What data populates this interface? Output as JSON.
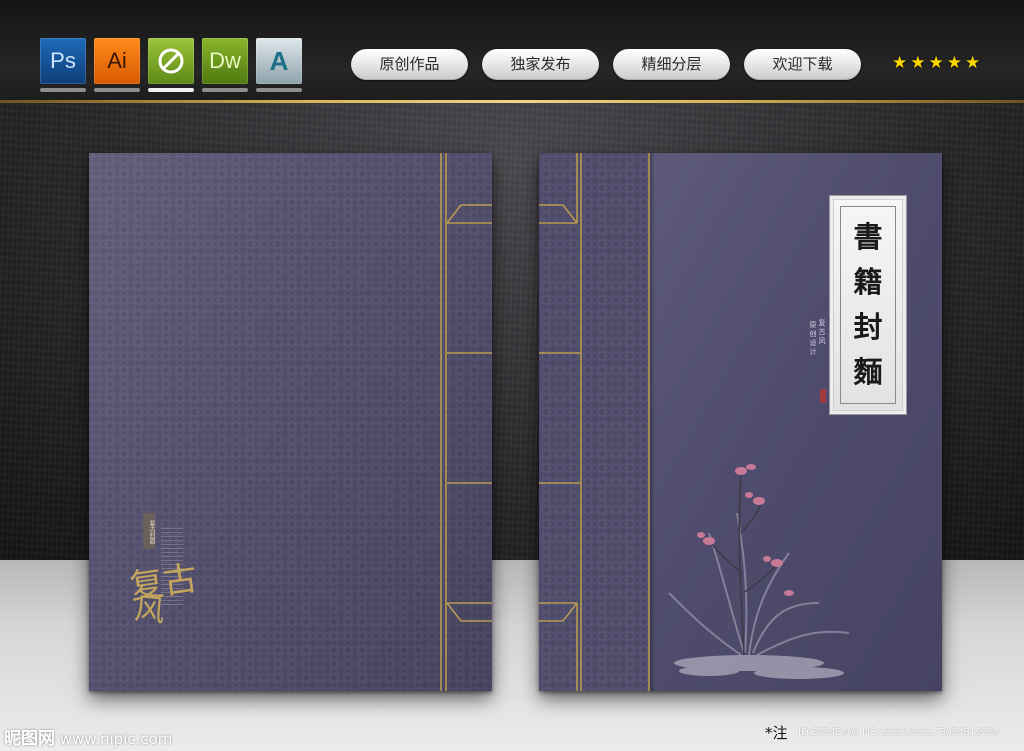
{
  "header": {
    "app_icons": [
      {
        "label": "Ps",
        "icon": "photoshop-icon",
        "color": "#1e6ab8"
      },
      {
        "label": "Ai",
        "icon": "illustrator-icon",
        "color": "#ff8a1a"
      },
      {
        "label": "",
        "icon": "coreldraw-icon",
        "color": "#9cc43a"
      },
      {
        "label": "Dw",
        "icon": "dreamweaver-icon",
        "color": "#8ab52c"
      },
      {
        "label": "A",
        "icon": "autocad-icon",
        "color": "#dfe8ec"
      }
    ],
    "pills": [
      "原创作品",
      "独家发布",
      "精细分层",
      "欢迎下载"
    ],
    "stars": [
      "★",
      "★",
      "★",
      "★",
      "★"
    ],
    "accent": "#d8b45a"
  },
  "left_book": {
    "calligraphy_top": "复古",
    "calligraphy_bottom": "风",
    "tag": "复古封面"
  },
  "right_book": {
    "title_chars": [
      "書",
      "籍",
      "封",
      "麵"
    ],
    "sub_a": "复古风",
    "sub_b": "原创设计"
  },
  "watermark": {
    "logo": "昵图网",
    "url": "www.nipic.com",
    "note": "*注",
    "id": "ID:25545906 NO:20200301173054819089"
  }
}
